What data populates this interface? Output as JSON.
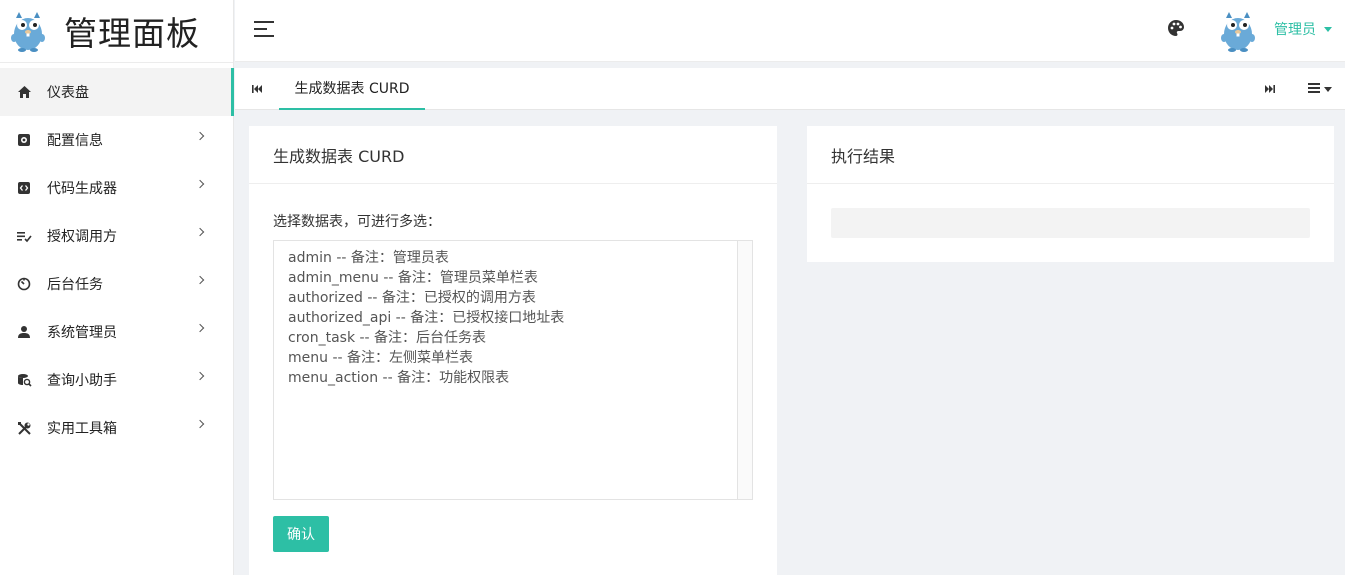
{
  "brand": {
    "title": "管理面板"
  },
  "sidebar": {
    "items": [
      {
        "label": "仪表盘",
        "icon": "home-icon",
        "active": true,
        "has_children": false
      },
      {
        "label": "配置信息",
        "icon": "settings-box-icon",
        "active": false,
        "has_children": true
      },
      {
        "label": "代码生成器",
        "icon": "code-icon",
        "active": false,
        "has_children": true
      },
      {
        "label": "授权调用方",
        "icon": "list-check-icon",
        "active": false,
        "has_children": true
      },
      {
        "label": "后台任务",
        "icon": "timer-icon",
        "active": false,
        "has_children": true
      },
      {
        "label": "系统管理员",
        "icon": "user-icon",
        "active": false,
        "has_children": true
      },
      {
        "label": "查询小助手",
        "icon": "database-search-icon",
        "active": false,
        "has_children": true
      },
      {
        "label": "实用工具箱",
        "icon": "tools-icon",
        "active": false,
        "has_children": true
      }
    ]
  },
  "header": {
    "user_label": "管理员"
  },
  "tabs": [
    {
      "label": "生成数据表 CURD",
      "active": true
    }
  ],
  "main": {
    "form_card": {
      "title": "生成数据表 CURD",
      "field_label": "选择数据表，可进行多选：",
      "options": [
        "admin -- 备注：管理员表",
        "admin_menu -- 备注：管理员菜单栏表",
        "authorized -- 备注：已授权的调用方表",
        "authorized_api -- 备注：已授权接口地址表",
        "cron_task -- 备注：后台任务表",
        "menu -- 备注：左侧菜单栏表",
        "menu_action -- 备注：功能权限表"
      ],
      "confirm_label": "确认"
    },
    "result_card": {
      "title": "执行结果"
    }
  },
  "colors": {
    "accent": "#2dbfa5",
    "background": "#f0f2f5"
  }
}
